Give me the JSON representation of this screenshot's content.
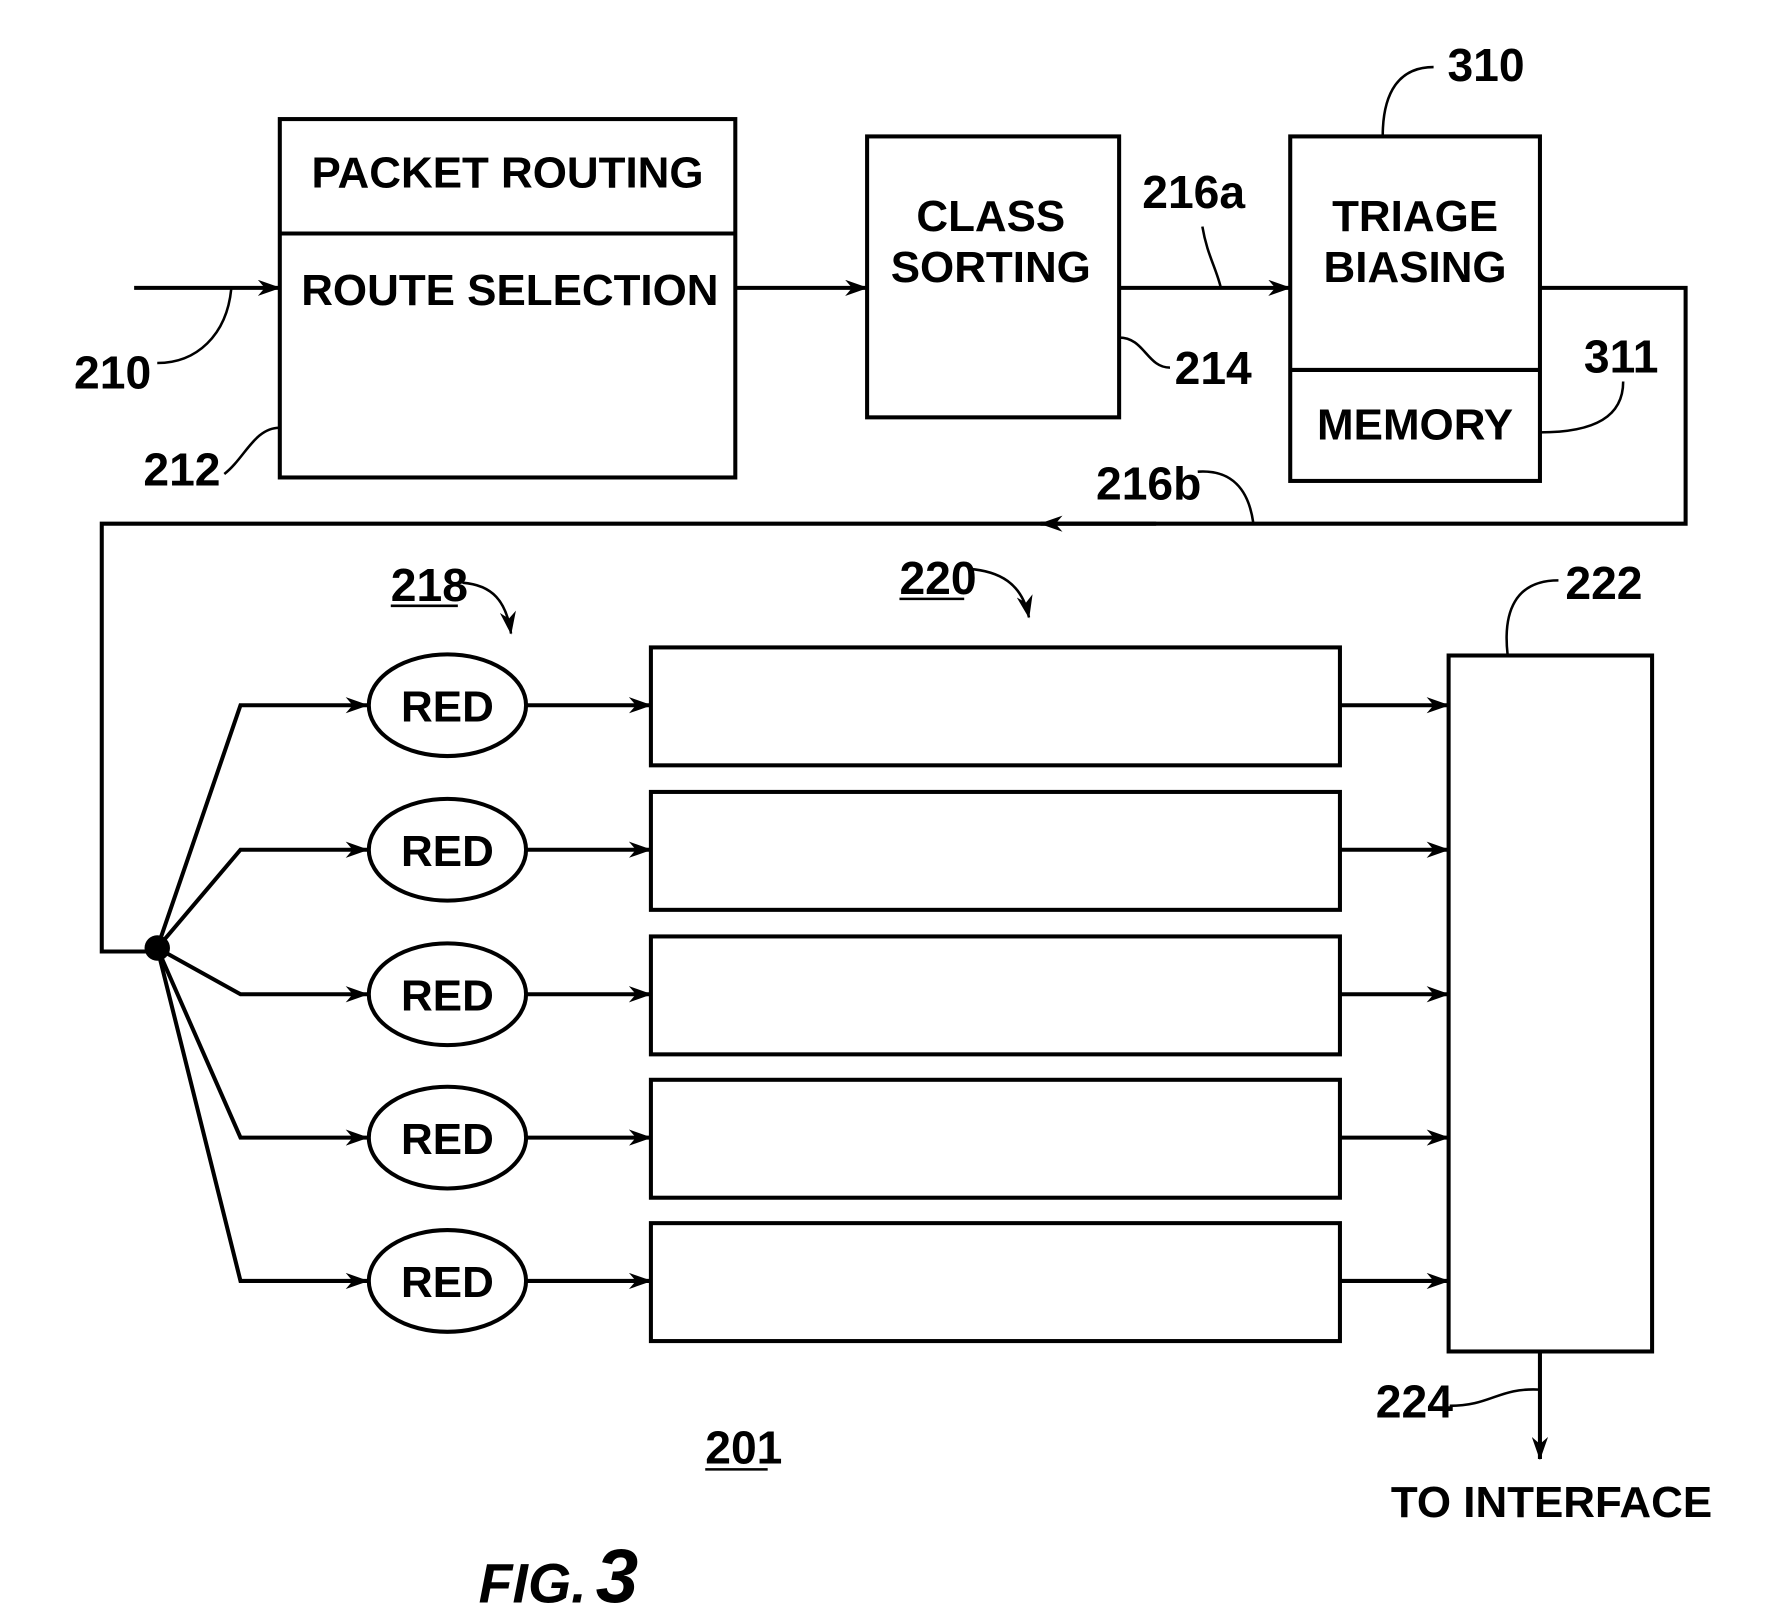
{
  "figure": {
    "caption_prefix": "FIG.",
    "caption_number": "3",
    "system_ref": "201"
  },
  "blocks": {
    "packet_routing": {
      "title": "PACKET ROUTING",
      "subtitle": "ROUTE SELECTION",
      "ref": "212"
    },
    "class_sorting": {
      "line1": "CLASS",
      "line2": "SORTING",
      "ref": "214"
    },
    "triage_biasing": {
      "line1": "TRIAGE",
      "line2": "BIASING",
      "ref": "310"
    },
    "memory": {
      "label": "MEMORY",
      "ref": "311"
    },
    "scheduler": {
      "ref": "222"
    }
  },
  "links": {
    "input": "210",
    "sorted_out": "216a",
    "biased_out": "216b",
    "output": "224",
    "output_label": "TO INTERFACE"
  },
  "red_group": {
    "ref": "218",
    "items": [
      "RED",
      "RED",
      "RED",
      "RED",
      "RED"
    ]
  },
  "queue_group": {
    "ref": "220",
    "count": 5
  }
}
